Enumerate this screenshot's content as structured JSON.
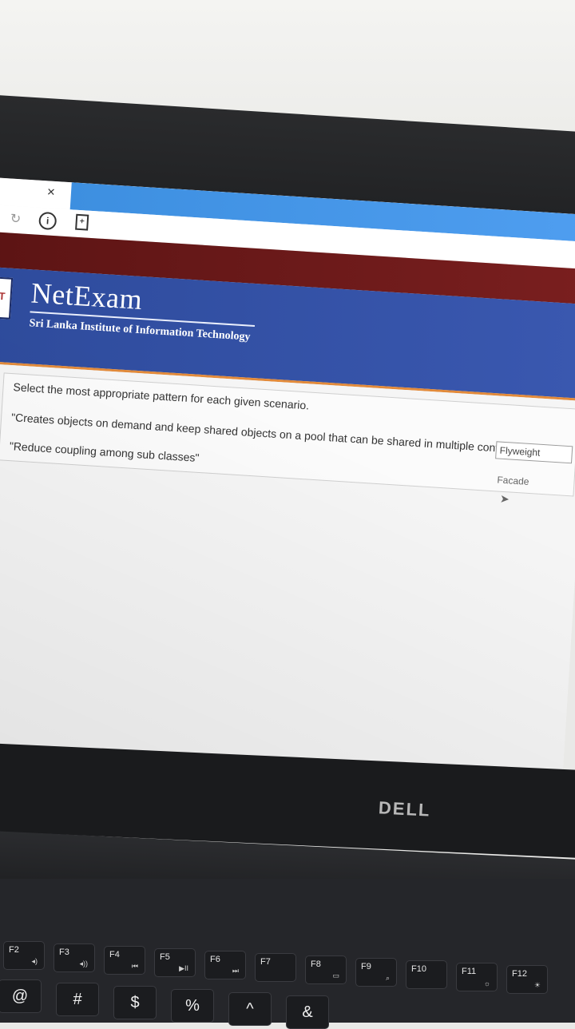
{
  "browser": {
    "tab_close": "×",
    "reload_icon": "↻",
    "info_icon": "i",
    "page_icon": "+"
  },
  "header": {
    "logo_text": "IT",
    "brand": "NetExam",
    "subtitle": "Sri Lanka Institute of Information Technology"
  },
  "question": {
    "instruction": "Select the most appropriate pattern for each given scenario.",
    "scenarios": [
      {
        "text": "\"Creates objects on demand and keep shared objects on a pool that can be shared in multiple contexts\"",
        "selected": "Flyweight"
      },
      {
        "text": "\"Reduce coupling among sub classes\"",
        "selected": "Facade"
      }
    ]
  },
  "hardware": {
    "brand": "DELL",
    "fkeys": [
      {
        "label": "F2",
        "sym": "◂)"
      },
      {
        "label": "F3",
        "sym": "◂))"
      },
      {
        "label": "F4",
        "sym": "⏮"
      },
      {
        "label": "F5",
        "sym": "▶II"
      },
      {
        "label": "F6",
        "sym": "⏭"
      },
      {
        "label": "F7",
        "sym": ""
      },
      {
        "label": "F8",
        "sym": "▭"
      },
      {
        "label": "F9",
        "sym": "⌕"
      },
      {
        "label": "F10",
        "sym": ""
      },
      {
        "label": "F11",
        "sym": "☼"
      },
      {
        "label": "F12",
        "sym": "☀"
      }
    ],
    "numkeys": [
      "@",
      "#",
      "$",
      "%",
      "^",
      "&"
    ]
  },
  "colors": {
    "tab_strip": "#3d8fe0",
    "red_bar": "#5c1414",
    "header_blue": "#2e4b9c",
    "header_rule": "#e28a3a"
  }
}
